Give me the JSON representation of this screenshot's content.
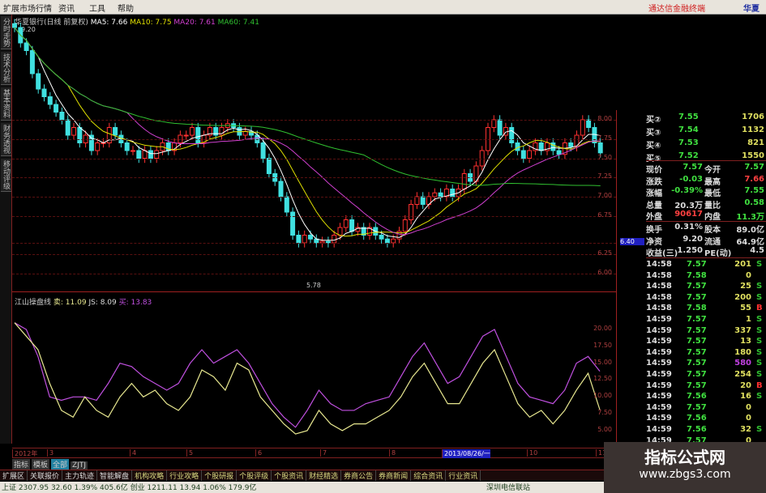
{
  "menu": [
    "扩展市场行情",
    "资讯",
    "工具",
    "帮助"
  ],
  "brand": "通达信金融终端",
  "brand_stock": "华夏",
  "left_tabs": [
    "分时走势",
    "技术分析",
    "基本资料",
    "财务透视",
    "移动评级"
  ],
  "title": {
    "stock": "华夏银行(日线 前复权)",
    "ma5": "MA5: 7.66",
    "ma10": "MA10: 7.75",
    "ma20": "MA20: 7.61",
    "ma60": "MA60: 7.41",
    "high_label": "9.20",
    "low_label": "5.78"
  },
  "indicator_title": {
    "name": "江山操盘线",
    "sell": "卖: 11.09",
    "js": "JS: 8.09",
    "buy": "买: 13.83"
  },
  "price_axis": [
    "8.00",
    "7.75",
    "7.50",
    "7.25",
    "7.00",
    "6.75",
    "6.40",
    "6.25",
    "6.00"
  ],
  "ind_axis": [
    "20.00",
    "17.50",
    "15.00",
    "12.50",
    "10.00",
    "7.50",
    "5.00"
  ],
  "colors": {
    "up": "#ff3030",
    "down": "#40e0e0",
    "ma5": "#ffffff",
    "ma10": "#e0e000",
    "ma20": "#d040d0",
    "ma60": "#30c030",
    "k": "#c050e0",
    "d": "#e8e890"
  },
  "chart_data": {
    "type": "candlestick",
    "closes": [
      9.2,
      9.0,
      8.9,
      8.6,
      8.4,
      8.3,
      8.2,
      8.1,
      8.0,
      7.8,
      7.9,
      7.7,
      7.8,
      7.6,
      7.7,
      7.7,
      7.9,
      7.8,
      7.7,
      7.6,
      7.6,
      7.5,
      7.6,
      7.5,
      7.6,
      7.7,
      7.6,
      7.7,
      7.8,
      7.8,
      7.9,
      7.7,
      7.8,
      7.9,
      7.8,
      7.9,
      7.95,
      7.9,
      7.8,
      7.85,
      7.8,
      7.7,
      7.5,
      7.3,
      7.2,
      7.0,
      6.8,
      6.5,
      6.4,
      6.5,
      6.45,
      6.4,
      6.42,
      6.4,
      6.5,
      6.6,
      6.7,
      6.55,
      6.6,
      6.5,
      6.6,
      6.5,
      6.45,
      6.4,
      6.45,
      6.55,
      6.7,
      6.9,
      7.0,
      6.9,
      7.0,
      7.05,
      7.0,
      7.1,
      7.0,
      7.1,
      7.3,
      7.2,
      7.4,
      7.6,
      7.9,
      8.0,
      7.8,
      7.9,
      7.7,
      7.6,
      7.5,
      7.6,
      7.7,
      7.6,
      7.7,
      7.6,
      7.55,
      7.7,
      7.65,
      7.8,
      8.0,
      7.9,
      7.7,
      7.57
    ],
    "indicator": {
      "buy": [
        21,
        20,
        16,
        10,
        9.5,
        10,
        10,
        9.5,
        12,
        15,
        14.5,
        13,
        12,
        11,
        12,
        15,
        17,
        15,
        16,
        17,
        15,
        12,
        9,
        7,
        5.5,
        8,
        11,
        9,
        8,
        8,
        9,
        9.5,
        10,
        13,
        16,
        18,
        15,
        12,
        13,
        16,
        19,
        20,
        16,
        12,
        10,
        9.5,
        9,
        11,
        15,
        16,
        13.8
      ],
      "sell": [
        21,
        19,
        17,
        12,
        8,
        7,
        10,
        8,
        7,
        10,
        12,
        10,
        11,
        9,
        8,
        10,
        14,
        13,
        11,
        15,
        14,
        10,
        8,
        6,
        4.5,
        5,
        8,
        6,
        5,
        6,
        6,
        7,
        8,
        10,
        13,
        15,
        12,
        9,
        9,
        12,
        15,
        17,
        13,
        9,
        7,
        8,
        6,
        8,
        11,
        13.5,
        8.1
      ]
    },
    "x_ticks": [
      "2012年",
      "3",
      "4",
      "5",
      "6",
      "7",
      "8",
      "2013/08/26/一",
      "10",
      "11"
    ]
  },
  "quote": {
    "bids": [
      [
        "买②",
        "7.55",
        "1706"
      ],
      [
        "买③",
        "7.54",
        "1132"
      ],
      [
        "买④",
        "7.53",
        "821"
      ],
      [
        "买⑤",
        "7.52",
        "1550"
      ]
    ],
    "stats1": [
      [
        "现价",
        "7.57",
        "今开",
        "7.57"
      ],
      [
        "涨跌",
        "-0.03",
        "最高",
        "7.66"
      ],
      [
        "涨幅",
        "-0.39%",
        "最低",
        "7.55"
      ],
      [
        "总量",
        "20.3万",
        "量比",
        "0.58"
      ],
      [
        "外盘",
        "90617",
        "内盘",
        "11.3万"
      ]
    ],
    "stats2": [
      [
        "换手",
        "0.31%",
        "股本",
        "89.0亿"
      ],
      [
        "净资",
        "9.20",
        "流通",
        "64.9亿"
      ],
      [
        "收益(三)",
        "1.250",
        "PE(动)",
        "4.5"
      ]
    ],
    "ticks": [
      [
        "14:58",
        "7.57",
        "201",
        "S"
      ],
      [
        "14:58",
        "7.58",
        "0",
        ""
      ],
      [
        "14:58",
        "7.57",
        "25",
        "S"
      ],
      [
        "14:58",
        "7.57",
        "200",
        "S"
      ],
      [
        "14:58",
        "7.58",
        "55",
        "B"
      ],
      [
        "14:59",
        "7.57",
        "1",
        "S"
      ],
      [
        "14:59",
        "7.57",
        "337",
        "S"
      ],
      [
        "14:59",
        "7.57",
        "13",
        "S"
      ],
      [
        "14:59",
        "7.57",
        "180",
        "S"
      ],
      [
        "14:59",
        "7.57",
        "580",
        "S"
      ],
      [
        "14:59",
        "7.57",
        "254",
        "S"
      ],
      [
        "14:59",
        "7.57",
        "20",
        "B"
      ],
      [
        "14:59",
        "7.56",
        "16",
        "S"
      ],
      [
        "14:59",
        "7.57",
        "0",
        ""
      ],
      [
        "14:59",
        "7.56",
        "0",
        ""
      ],
      [
        "14:59",
        "7.56",
        "32",
        "S"
      ],
      [
        "14:59",
        "7.57",
        "0",
        ""
      ]
    ]
  },
  "tabs1": [
    "指标",
    "模板",
    "全部",
    "ZJTJ"
  ],
  "tabs2": [
    "扩展区",
    "关联报价",
    "主力轨迹",
    "智能解盘",
    "机构攻略",
    "行业攻略",
    "个股研报",
    "个股评级",
    "个股资讯",
    "财经精选",
    "券商公告",
    "券商新闻",
    "综合资讯",
    "行业资讯"
  ],
  "status": "上证 2307.95  32.60  1.39%  405.6亿  创业 1211.11  13.94  1.06%  179.9亿",
  "status_right": "深圳电信联站",
  "watermark": {
    "title": "指标公式网",
    "url": "www.zbgs3.com"
  }
}
